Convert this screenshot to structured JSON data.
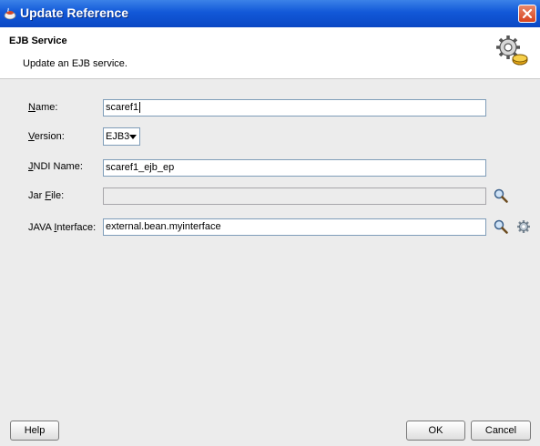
{
  "window": {
    "title": "Update Reference"
  },
  "header": {
    "title": "EJB Service",
    "description": "Update an EJB service.",
    "icon": "gear-wizard-icon"
  },
  "form": {
    "name": {
      "label_pre": "",
      "label_mn": "N",
      "label_post": "ame:",
      "value": "scaref1"
    },
    "version": {
      "label_pre": "",
      "label_mn": "V",
      "label_post": "ersion:",
      "value": "EJB3"
    },
    "jndi": {
      "label_pre": "",
      "label_mn": "J",
      "label_post": "NDI Name:",
      "value": "scaref1_ejb_ep"
    },
    "jar": {
      "label_pre": "Jar ",
      "label_mn": "F",
      "label_post": "ile:",
      "value": ""
    },
    "java_interface": {
      "label_pre": "JAVA ",
      "label_mn": "I",
      "label_post": "nterface:",
      "value": "external.bean.myinterface"
    }
  },
  "buttons": {
    "help": "Help",
    "ok": "OK",
    "cancel": "Cancel"
  }
}
